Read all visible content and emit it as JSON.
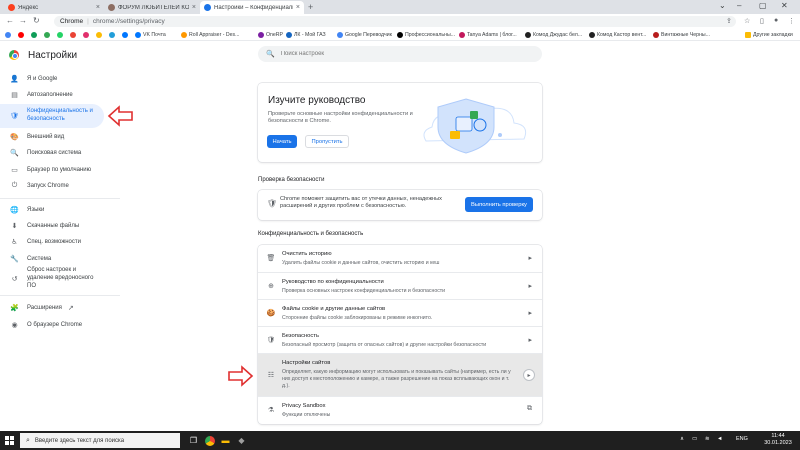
{
  "tabs": [
    {
      "title": "Яндекс",
      "color": "#fc3f1d",
      "active": false
    },
    {
      "title": "ФОРУМ ЛЮБИТЕЛЕЙ КОЛЛИ",
      "color": "#8d6e63",
      "active": false
    },
    {
      "title": "Настройки – Конфиденциальность",
      "color": "#1a73e8",
      "active": true
    }
  ],
  "address": {
    "site": "Chrome",
    "url": "chrome://settings/privacy"
  },
  "bookmarks": [
    {
      "label": "",
      "color": "#4285f4"
    },
    {
      "label": "",
      "color": "#ff0000"
    },
    {
      "label": "",
      "color": "#0f9d58"
    },
    {
      "label": "",
      "color": "#25d366"
    },
    {
      "label": "",
      "color": "#e1306c"
    },
    {
      "label": "",
      "color": "#229ed9"
    },
    {
      "label": "VK Почта",
      "color": "#0077ff"
    },
    {
      "label": "Roll Appraiser - Des...",
      "color": "#ff9800"
    },
    {
      "label": "OneRP",
      "color": "#7b1fa2"
    },
    {
      "label": "ЛК - Мой ГАЗ",
      "color": "#1565c0"
    },
    {
      "label": "Google Переводчик",
      "color": "#4285f4"
    },
    {
      "label": "Профессиональны...",
      "color": "#000000"
    },
    {
      "label": "Tanya Adams | блог...",
      "color": "#c2185b"
    },
    {
      "label": "Комод Джудас бел...",
      "color": "#212121"
    },
    {
      "label": "Комод Кастор вент...",
      "color": "#212121"
    },
    {
      "label": "Винтажные Черны...",
      "color": "#b71c1c"
    },
    {
      "label": "Другие закладки",
      "color": "#fbbc05"
    }
  ],
  "header": {
    "title": "Настройки",
    "search_placeholder": "Поиск настроек"
  },
  "sidebar": {
    "items": [
      {
        "label": "Я и Google",
        "icon": "👤"
      },
      {
        "label": "Автозаполнение",
        "icon": "▤"
      },
      {
        "label": "Конфиденциальность и безопасность",
        "icon": "🛡"
      },
      {
        "label": "Внешний вид",
        "icon": "🎨"
      },
      {
        "label": "Поисковая система",
        "icon": "🔍"
      },
      {
        "label": "Браузер по умолчанию",
        "icon": "▭"
      },
      {
        "label": "Запуск Chrome",
        "icon": "⏻"
      },
      {
        "label": "Языки",
        "icon": "🌐"
      },
      {
        "label": "Скачанные файлы",
        "icon": "⬇"
      },
      {
        "label": "Спец. возможности",
        "icon": "♿"
      },
      {
        "label": "Система",
        "icon": "🔧"
      },
      {
        "label": "Сброс настроек и удаление вредоносного ПО",
        "icon": "↺"
      },
      {
        "label": "Расширения",
        "icon": "🧩"
      },
      {
        "label": "О браузере Chrome",
        "icon": "◉"
      }
    ]
  },
  "promo": {
    "title": "Изучите руководство",
    "description": "Проверьте основные настройки конфиденциальности и безопасности в Chrome.",
    "start": "Начать",
    "skip": "Пропустить"
  },
  "safety": {
    "heading": "Проверка безопасности",
    "text": "Chrome поможет защитить вас от утечки данных, ненадежных расширений и других проблем с безопасностью.",
    "button": "Выполнить проверку"
  },
  "privacy": {
    "heading": "Конфиденциальность и безопасность",
    "rows": [
      {
        "title": "Очистить историю",
        "desc": "Удалить файлы cookie и данные сайтов, очистить историю и кеш",
        "icon": "🗑"
      },
      {
        "title": "Руководство по конфиденциальности",
        "desc": "Проверка основных настроек конфиденциальности и безопасности",
        "icon": "⊕"
      },
      {
        "title": "Файлы cookie и другие данные сайтов",
        "desc": "Сторонние файлы cookie заблокированы в режиме инкогнито.",
        "icon": "🍪"
      },
      {
        "title": "Безопасность",
        "desc": "Безопасный просмотр (защита от опасных сайтов) и другие настройки безопасности",
        "icon": "🛡"
      },
      {
        "title": "Настройки сайтов",
        "desc": "Определяет, какую информацию могут использовать и показывать сайты (например, есть ли у них доступ к местоположению и камере, а также разрешение на показ всплывающих окон и т. д.).",
        "icon": "☷"
      },
      {
        "title": "Privacy Sandbox",
        "desc": "Функции отключены",
        "icon": "⚗"
      }
    ]
  },
  "taskbar": {
    "search_placeholder": "Введите здесь текст для поиска",
    "lang": "ENG",
    "time": "11:44",
    "date": "30.01.2023"
  }
}
